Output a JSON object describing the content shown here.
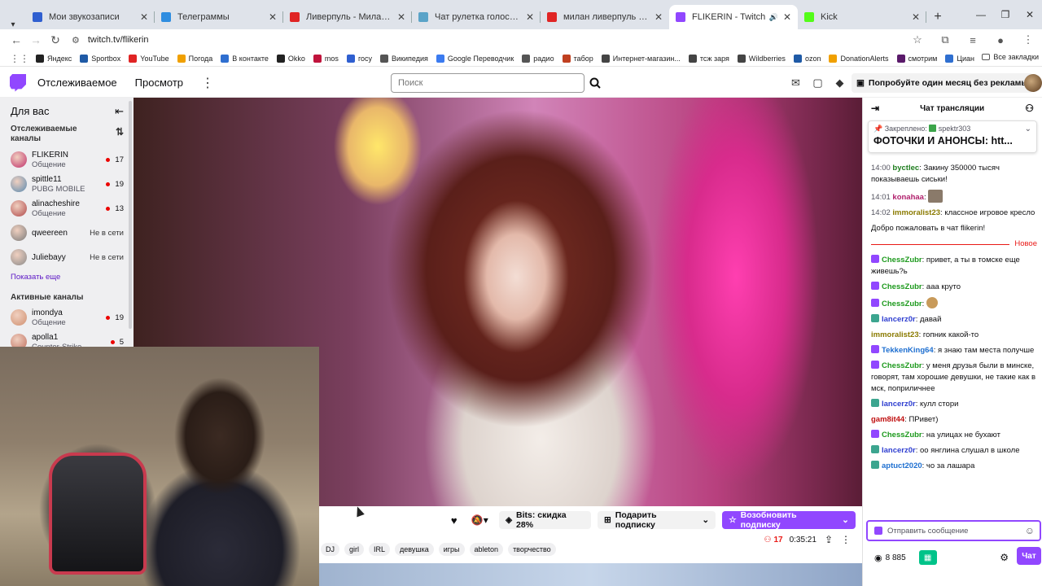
{
  "tabs": [
    {
      "label": "Мои звукозаписи",
      "color": "#2f5fd0"
    },
    {
      "label": "Телеграммы",
      "color": "#2f8de0"
    },
    {
      "label": "Ливерпуль - Милан. Повтор",
      "color": "#e02424"
    },
    {
      "label": "Чат рулетка голосовая — Nek",
      "color": "#5aa3c8"
    },
    {
      "label": "милан ливерпуль - YouTube",
      "color": "#e02424"
    },
    {
      "label": "FLIKERIN - Twitch",
      "color": "#9147ff"
    },
    {
      "label": "Kick",
      "color": "#53fc18"
    }
  ],
  "address": {
    "url": "twitch.tv/flikerin"
  },
  "bookmarks": [
    {
      "label": "Яндекс",
      "color": "#222"
    },
    {
      "label": "Sportbox",
      "color": "#1f5aa6"
    },
    {
      "label": "YouTube",
      "color": "#e02424"
    },
    {
      "label": "Погода",
      "color": "#f0a000"
    },
    {
      "label": "В контакте",
      "color": "#2f6fd0"
    },
    {
      "label": "Okko",
      "color": "#222"
    },
    {
      "label": "mos",
      "color": "#c0143c"
    },
    {
      "label": "госу",
      "color": "#2f5fd0"
    },
    {
      "label": "Википедия",
      "color": "#555"
    },
    {
      "label": "Google Переводчик",
      "color": "#3b7bf0"
    },
    {
      "label": "радио",
      "color": "#555"
    },
    {
      "label": "табор",
      "color": "#c04020"
    },
    {
      "label": "Интернет-магазин...",
      "color": "#444"
    },
    {
      "label": "тсж заря",
      "color": "#444"
    },
    {
      "label": "Wildberries",
      "color": "#444"
    },
    {
      "label": "ozon",
      "color": "#1f5aa6"
    },
    {
      "label": "DonationAlerts",
      "color": "#f0a000"
    },
    {
      "label": "смотрим",
      "color": "#5a1a6a"
    },
    {
      "label": "Циан",
      "color": "#2f6fd0"
    }
  ],
  "bookmarks_all": "Все закладки",
  "twitch": {
    "nav_following": "Отслеживаемое",
    "nav_browse": "Просмотр",
    "search_placeholder": "Поиск",
    "promo": "Попробуйте один месяц без рекламы"
  },
  "sidebar": {
    "for_you": "Для вас",
    "followed_title": "Отслеживаемые каналы",
    "followed": [
      {
        "name": "FLIKERIN",
        "game": "Общение",
        "viewers": "17",
        "color": "#c0306a"
      },
      {
        "name": "spittle11",
        "game": "PUBG MOBILE",
        "viewers": "19",
        "color": "#5a8ab0"
      },
      {
        "name": "alinacheshire",
        "game": "Общение",
        "viewers": "13",
        "color": "#b0484a"
      },
      {
        "name": "qweereen",
        "status": "Не в сети",
        "color": "#7a7a7a"
      },
      {
        "name": "Juliebayy",
        "status": "Не в сети",
        "color": "#8a8a8a"
      }
    ],
    "show_more": "Показать еще",
    "active_title": "Активные каналы",
    "active": [
      {
        "name": "imondya",
        "game": "Общение",
        "viewers": "19",
        "color": "#d09070"
      },
      {
        "name": "apolla1",
        "game": "Counter-Strike",
        "viewers": "5",
        "color": "#c07060"
      }
    ]
  },
  "player": {
    "bits": "Bits: скидка 28%",
    "gift": "Подарить подписку",
    "renew": "Возобновить подписку",
    "tags": [
      "DJ",
      "girl",
      "IRL",
      "девушка",
      "игры",
      "ableton",
      "творчество"
    ],
    "viewers": "17",
    "uptime": "0:35:21"
  },
  "chat": {
    "title": "Чат трансляции",
    "pinned_by": "Закреплено:",
    "pinned_user": "spektr303",
    "pinned_text": "ФОТОЧКИ И АНОНСЫ: htt...",
    "before": [
      {
        "time": "14:00",
        "user": "byctlec",
        "color": "#1e7d1e",
        "text": "Закину 350000 тысяч показываешь сиськи!"
      },
      {
        "time": "14:01",
        "user": "konahaa",
        "color": "#b1216d",
        "text": ""
      },
      {
        "time": "14:02",
        "user": "immoralist23",
        "color": "#8a7a00",
        "text": "классное игровое кресло"
      }
    ],
    "welcome": "Добро пожаловать в чат flikerin!",
    "new_label": "Новое",
    "messages": [
      {
        "user": "ChessZubr",
        "color": "#1e9a1e",
        "badge": "p",
        "text": "привет, а ты в томске еще живешь?ь"
      },
      {
        "user": "ChessZubr",
        "color": "#1e9a1e",
        "badge": "p",
        "text": "ааа круто"
      },
      {
        "user": "ChessZubr",
        "color": "#1e9a1e",
        "badge": "p",
        "text": ""
      },
      {
        "user": "lancerz0r",
        "color": "#2f3fd0",
        "badge": "g",
        "text": "давай"
      },
      {
        "user": "immoralist23",
        "color": "#8a7a00",
        "badge": "",
        "text": "гопник какой-то"
      },
      {
        "user": "TekkenKing64",
        "color": "#1e6fd0",
        "badge": "p",
        "text": "я знаю там места получше"
      },
      {
        "user": "ChessZubr",
        "color": "#1e9a1e",
        "badge": "p",
        "text": "у меня друзья были в минске, говорят, там хорошие девушки, не такие как в мск, поприличнее"
      },
      {
        "user": "lancerz0r",
        "color": "#2f3fd0",
        "badge": "g",
        "text": "кулл стори"
      },
      {
        "user": "gam8it44",
        "color": "#c01010",
        "badge": "",
        "text": "ПРивет)"
      },
      {
        "user": "ChessZubr",
        "color": "#1e9a1e",
        "badge": "p",
        "text": "на улицах не бухают"
      },
      {
        "user": "lancerz0r",
        "color": "#2f3fd0",
        "badge": "g",
        "text": "оо янглина слушал в школе"
      },
      {
        "user": "aptuct2020",
        "color": "#1e6fd0",
        "badge": "g",
        "text": "чо за лашара"
      }
    ],
    "input_placeholder": "Отправить сообщение",
    "points": "8 885",
    "chat_button": "Чат"
  }
}
